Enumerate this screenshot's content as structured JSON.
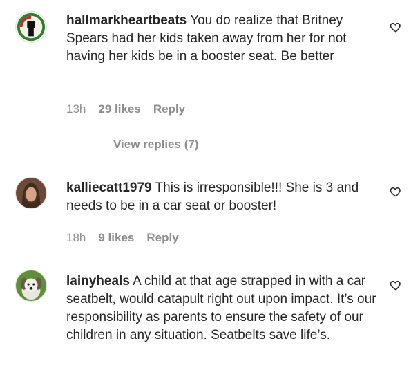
{
  "comments": [
    {
      "username": "hallmarkheartbeats",
      "text": "You do realize that Britney Spears had her kids taken away from her for not having her kids be in a booster seat. Be better",
      "time": "13h",
      "likes": "29 likes",
      "reply": "Reply",
      "view_replies": "View replies (7)",
      "avatar_icon": "raised-fist-avatar"
    },
    {
      "username": "kalliecatt1979",
      "text": "This is irresponsible!!! She is 3 and needs to be in a car seat or booster!",
      "time": "18h",
      "likes": "9 likes",
      "reply": "Reply",
      "avatar_icon": "profile-photo-avatar"
    },
    {
      "username": "lainyheals",
      "text": "A child at that age strapped in with a car seatbelt, would catapult right out upon impact. It’s our responsibility as parents to ensure the safety of our children in any situation. Seatbelts save life’s.",
      "avatar_icon": "dog-photo-avatar"
    }
  ],
  "colors": {
    "text": "#262626",
    "secondary": "#8e8e8e",
    "background": "#ffffff"
  }
}
